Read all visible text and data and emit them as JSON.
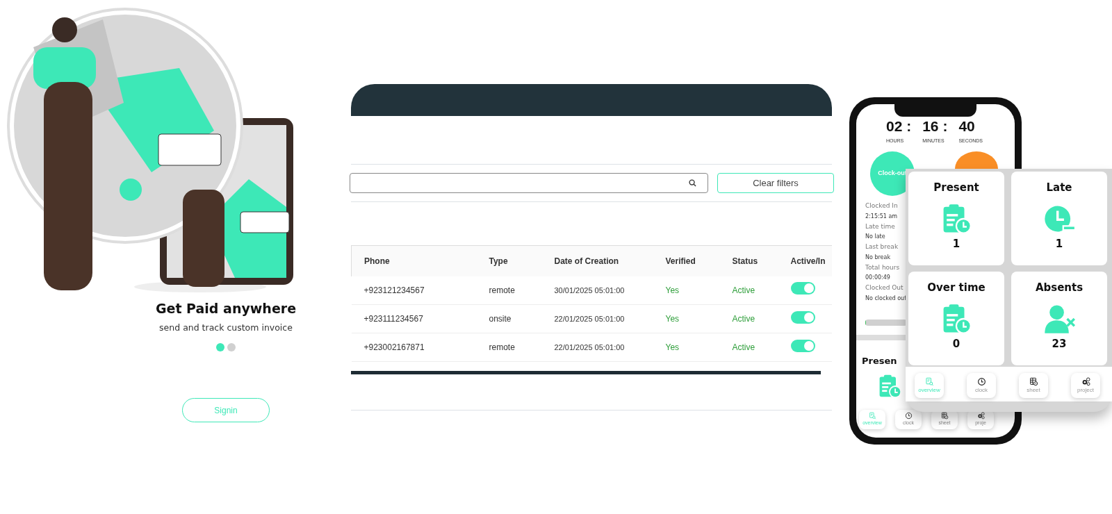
{
  "onboarding": {
    "title": "Get Paid anywhere",
    "subtitle": "send and track custom invoice",
    "dots": [
      {
        "selected": true
      },
      {
        "selected": false
      }
    ],
    "button": "Signin"
  },
  "users_table": {
    "clear_button": "Clear filters",
    "columns": [
      "Phone",
      "Type",
      "Date of Creation",
      "Verified",
      "Status",
      "Active/In"
    ],
    "rows": [
      {
        "phone": "+923121234567",
        "type": "remote",
        "created": "30/01/2025 05:01:00",
        "verified": "Yes",
        "status": "Active",
        "on": true
      },
      {
        "phone": "+923111234567",
        "type": "onsite",
        "created": "22/01/2025 05:01:00",
        "verified": "Yes",
        "status": "Active",
        "on": true
      },
      {
        "phone": "+923002167871",
        "type": "remote",
        "created": "22/01/2025 05:01:00",
        "verified": "Yes",
        "status": "Active",
        "on": true
      }
    ]
  },
  "phone": {
    "timer": [
      {
        "value": "02 :",
        "unit": "HOURS"
      },
      {
        "value": "16 :",
        "unit": "MINUTES"
      },
      {
        "value": "40",
        "unit": "SECONDS"
      }
    ],
    "clock_button": "Clock-out",
    "details": [
      {
        "label": "Clocked In",
        "value": "2:15:51 am"
      },
      {
        "label": "Late time",
        "value": "No late"
      },
      {
        "label": "Last break",
        "value": "No break"
      },
      {
        "label": "Total hours",
        "value": "00:00:49"
      },
      {
        "label": "Clocked Out",
        "value": "No clocked out"
      }
    ],
    "progress": {
      "level": 0.02
    },
    "card_title": "Presen",
    "nav": [
      {
        "label": "overview",
        "kind": "overview",
        "selected": true
      },
      {
        "label": "clock",
        "kind": "clock",
        "selected": false
      },
      {
        "label": "sheet",
        "kind": "sheet",
        "selected": false
      },
      {
        "label": "proje",
        "kind": "project",
        "selected": false
      }
    ]
  },
  "overview_panel": {
    "cards": [
      {
        "title": "Present",
        "kind": "clipboard",
        "count": "1"
      },
      {
        "title": "Late",
        "kind": "late",
        "count": "1"
      },
      {
        "title": "Over time",
        "kind": "clipboard",
        "count": "0"
      },
      {
        "title": "Absents",
        "kind": "absent",
        "count": "23"
      }
    ],
    "nav": [
      {
        "label": "overview",
        "kind": "overview",
        "selected": true
      },
      {
        "label": "clock",
        "kind": "clock",
        "selected": false
      },
      {
        "label": "sheet",
        "kind": "sheet",
        "selected": false
      },
      {
        "label": "project",
        "kind": "project",
        "selected": false
      }
    ]
  }
}
